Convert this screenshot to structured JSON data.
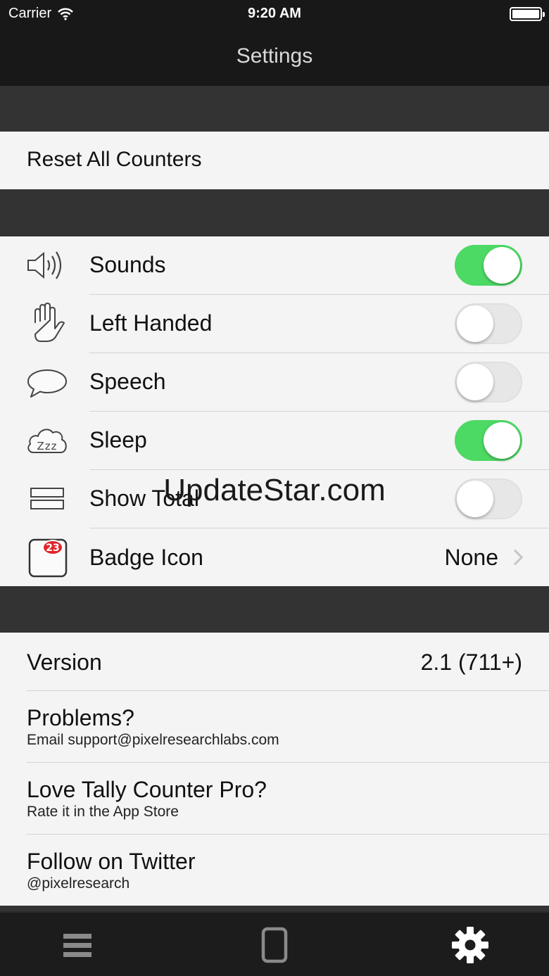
{
  "status_bar": {
    "carrier": "Carrier",
    "time": "9:20 AM",
    "wifi_icon": "wifi-icon",
    "battery_icon": "battery-icon"
  },
  "nav": {
    "title": "Settings"
  },
  "reset": {
    "label": "Reset All Counters"
  },
  "settings": [
    {
      "label": "Sounds",
      "icon": "speaker-icon",
      "type": "toggle",
      "on": true
    },
    {
      "label": "Left Handed",
      "icon": "hand-icon",
      "type": "toggle",
      "on": false
    },
    {
      "label": "Speech",
      "icon": "speech-bubble-icon",
      "type": "toggle",
      "on": false
    },
    {
      "label": "Sleep",
      "icon": "sleep-cloud-icon",
      "type": "toggle",
      "on": true
    },
    {
      "label": "Show Total",
      "icon": "total-bars-icon",
      "type": "toggle",
      "on": false
    },
    {
      "label": "Badge Icon",
      "icon": "badge-calendar-icon",
      "type": "disclosure",
      "value": "None",
      "badge_number": "23"
    }
  ],
  "info": {
    "version_label": "Version",
    "version_value": "2.1  (711+)",
    "problems_title": "Problems?",
    "problems_sub": "Email support@pixelresearchlabs.com",
    "rate_title": "Love Tally Counter Pro?",
    "rate_sub": "Rate it in the App Store",
    "twitter_title": "Follow on Twitter",
    "twitter_sub": "@pixelresearch"
  },
  "watermark": "UpdateStar.com",
  "tab_bar": {
    "tabs": [
      {
        "icon": "list-icon",
        "active": false
      },
      {
        "icon": "phone-icon",
        "active": false
      },
      {
        "icon": "gear-icon",
        "active": true
      }
    ]
  },
  "colors": {
    "toggle_on": "#4cd964",
    "background_dark": "#333333",
    "bar_dark": "#181818",
    "cell_background": "#f4f4f4"
  }
}
